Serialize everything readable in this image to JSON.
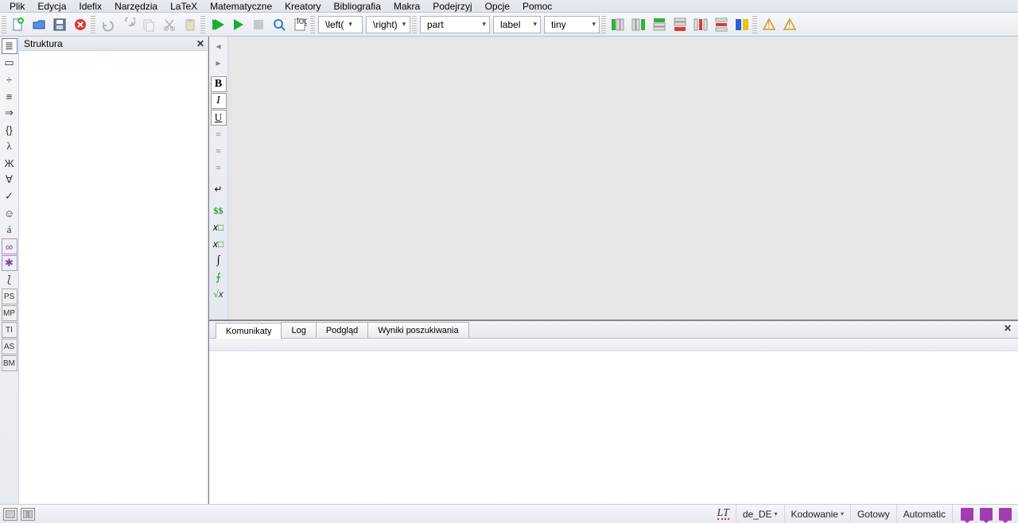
{
  "menu": [
    "Plik",
    "Edycja",
    "Idefix",
    "Narzędzia",
    "LaTeX",
    "Matematyczne",
    "Kreatory",
    "Bibliografia",
    "Makra",
    "Podejrzyj",
    "Opcje",
    "Pomoc"
  ],
  "combos": {
    "left": "\\left(",
    "right": "\\right)",
    "section": "part",
    "ref": "label",
    "size": "tiny"
  },
  "structure": {
    "title": "Struktura"
  },
  "left_icons": [
    "≣",
    "▭",
    "÷",
    "≡",
    "⇒",
    "{}",
    "λ",
    "Ж",
    "∀",
    "✓",
    "☺",
    "á",
    "∞",
    "✱",
    "⟅",
    "PS",
    "MP",
    "TI",
    "AS",
    "BM"
  ],
  "vert_icons": [
    "B",
    "I",
    "U",
    "≡",
    "≡",
    "≡",
    "↵",
    "$$",
    "xₐ",
    "xᵃ",
    "∫",
    "∱",
    "√x"
  ],
  "bottom_tabs": [
    "Komunikaty",
    "Log",
    "Podgląd",
    "Wyniki poszukiwania"
  ],
  "status": {
    "lt": "LT",
    "lang": "de_DE",
    "encoding": "Kodowanie",
    "ready": "Gotowy",
    "auto": "Automatic"
  }
}
